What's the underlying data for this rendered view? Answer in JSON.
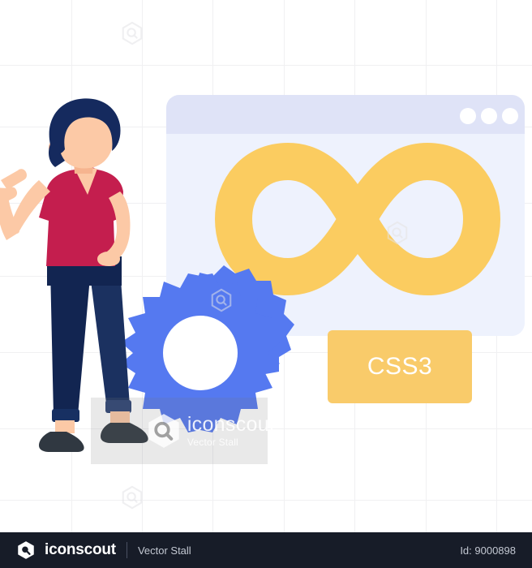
{
  "illustration": {
    "title": "CSS3 infinity development illustration",
    "browser_window": {
      "name": "browser-mockup",
      "header_dots": [
        "dot-1",
        "dot-2",
        "dot-3"
      ],
      "header_color": "#dfe3f7",
      "body_color": "#eef2fd",
      "content_icon": "infinity-symbol",
      "content_icon_color": "#fbcc60"
    },
    "label_card": {
      "text": "CSS3",
      "background": "#f9cb6a",
      "text_color": "#ffffff"
    },
    "gear": {
      "name": "gear-icon",
      "color": "#5579f0"
    },
    "character": {
      "name": "man-pointing",
      "hair_color": "#152a5e",
      "skin_color": "#fcc9a6",
      "shirt_color": "#c41e4e",
      "pants_color": "#122551",
      "shoe_color": "#303841"
    },
    "background": {
      "grid_color": "#f0f0f2",
      "page_color": "#ffffff"
    }
  },
  "watermark": {
    "brand": "iconscout",
    "vendor": "Vector Stall",
    "hex_icon": "iconscout-hex-logo"
  },
  "footer": {
    "logo_icon": "iconscout-hex-logo",
    "brand": "iconscout",
    "vendor": "Vector Stall",
    "id_label": "Id: 9000898"
  }
}
